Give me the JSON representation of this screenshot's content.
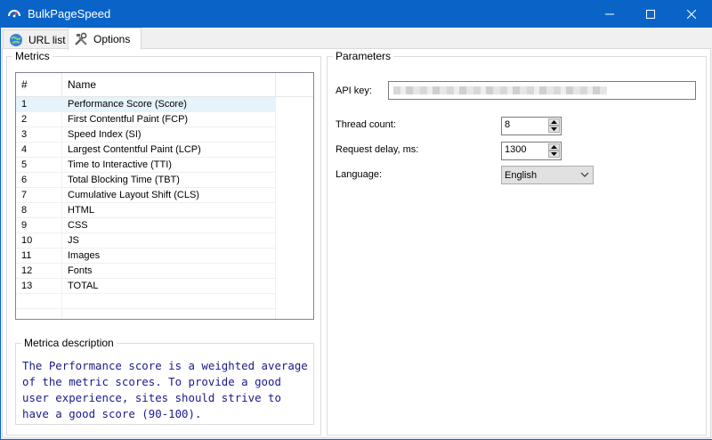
{
  "window": {
    "title": "BulkPageSpeed"
  },
  "tabs": [
    {
      "label": "URL list"
    },
    {
      "label": "Options"
    }
  ],
  "metrics": {
    "group_title": "Metrics",
    "columns": [
      "#",
      "Name"
    ],
    "rows": [
      {
        "num": "1",
        "name": "Performance Score (Score)"
      },
      {
        "num": "2",
        "name": "First Contentful Paint (FCP)"
      },
      {
        "num": "3",
        "name": "Speed Index (SI)"
      },
      {
        "num": "4",
        "name": "Largest Contentful Paint (LCP)"
      },
      {
        "num": "5",
        "name": "Time to Interactive (TTI)"
      },
      {
        "num": "6",
        "name": "Total Blocking Time (TBT)"
      },
      {
        "num": "7",
        "name": "Cumulative Layout Shift (CLS)"
      },
      {
        "num": "8",
        "name": "HTML"
      },
      {
        "num": "9",
        "name": "CSS"
      },
      {
        "num": "10",
        "name": "JS"
      },
      {
        "num": "11",
        "name": "Images"
      },
      {
        "num": "12",
        "name": "Fonts"
      },
      {
        "num": "13",
        "name": "TOTAL"
      }
    ],
    "selected_row": "1"
  },
  "description": {
    "group_title": "Metrica description",
    "text": "The Performance score is a weighted average of the metric scores. To provide a good user experience, sites should strive to have a good score (90-100)."
  },
  "parameters": {
    "group_title": "Parameters",
    "api_key_label": "API key:",
    "thread_count_label": "Thread count:",
    "thread_count_value": "8",
    "request_delay_label": "Request delay, ms:",
    "request_delay_value": "1300",
    "language_label": "Language:",
    "language_value": "English"
  },
  "colors": {
    "titlebar": "#0a64c8",
    "description_text": "#1a1a8c",
    "selected_row": "#e5f3fb"
  }
}
